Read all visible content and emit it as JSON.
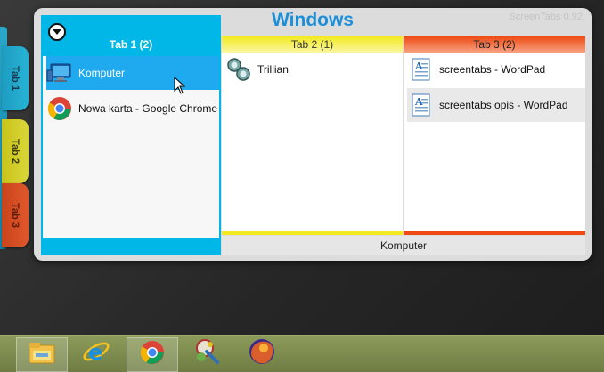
{
  "window": {
    "title": "Windows",
    "version": "ScreenTabs 0.92",
    "status_text": "Komputer"
  },
  "side_tabs": [
    {
      "label": "Tab 1"
    },
    {
      "label": "Tab 2"
    },
    {
      "label": "Tab 3"
    }
  ],
  "columns": [
    {
      "header": "Tab 1 (2)",
      "color": "#00b7e8",
      "items": [
        {
          "label": "Komputer",
          "icon": "computer-icon",
          "selected": true
        },
        {
          "label": "Nowa karta - Google Chrome",
          "icon": "chrome-icon",
          "selected": false
        }
      ]
    },
    {
      "header": "Tab 2 (1)",
      "color": "#f2ea1e",
      "items": [
        {
          "label": "Trillian",
          "icon": "trillian-icon",
          "selected": false
        }
      ]
    },
    {
      "header": "Tab 3 (2)",
      "color": "#ee4a12",
      "items": [
        {
          "label": "screentabs - WordPad",
          "icon": "wordpad-icon",
          "selected": false
        },
        {
          "label": "screentabs opis - WordPad",
          "icon": "wordpad-icon",
          "selected": false
        }
      ]
    }
  ],
  "taskbar": [
    {
      "name": "file-explorer",
      "icon": "folder-icon",
      "active": true
    },
    {
      "name": "internet-explorer",
      "icon": "ie-icon",
      "active": false
    },
    {
      "name": "chrome",
      "icon": "chrome-icon",
      "active": true
    },
    {
      "name": "paint-tool",
      "icon": "brush-icon",
      "active": false
    },
    {
      "name": "firefox",
      "icon": "firefox-icon",
      "active": false
    }
  ]
}
